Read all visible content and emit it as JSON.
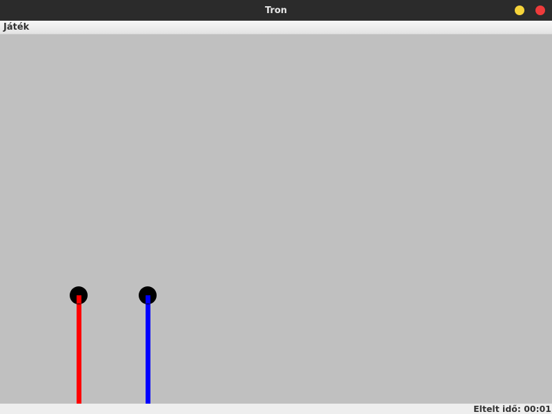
{
  "window": {
    "title": "Tron"
  },
  "menu": {
    "items": [
      "Játék"
    ]
  },
  "status": {
    "elapsed_label": "Eltelt idő: 00:01"
  },
  "players": [
    {
      "name": "red",
      "color": "#ff0000",
      "direction": "up"
    },
    {
      "name": "blue",
      "color": "#0000ff",
      "direction": "up"
    }
  ],
  "colors": {
    "arena_background": "#c0c0c0",
    "titlebar": "#2b2b2b",
    "minimize_button": "#f5d33a",
    "close_button": "#ef3b3b",
    "bike_head": "#000000"
  }
}
